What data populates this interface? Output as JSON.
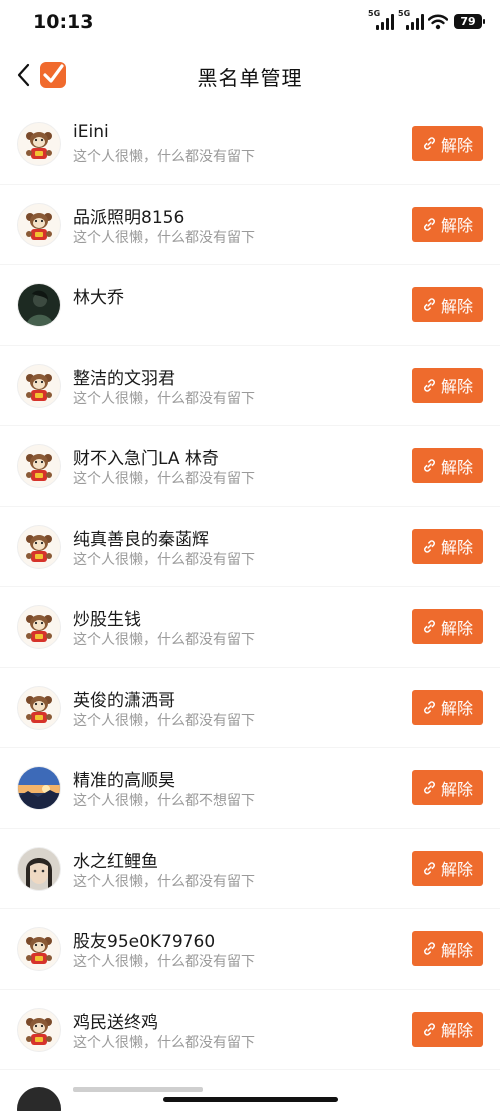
{
  "status_bar": {
    "time": "10:13",
    "signal1_label": "5G",
    "signal2_label": "5G",
    "battery": "79"
  },
  "nav": {
    "title": "黑名单管理",
    "back_icon": "chevron-left-icon",
    "logo_icon": "checkmark-logo-icon"
  },
  "list": {
    "unblock_label": "解除",
    "unblock_icon": "link-icon",
    "items": [
      {
        "name": "iEini",
        "bio": "这个人很懒，什么都没有留下",
        "avatar": "cartoon"
      },
      {
        "name": "品派照明8156",
        "bio": "这个人很懒，什么都没有留下",
        "avatar": "cartoon"
      },
      {
        "name": "林大乔",
        "bio": "",
        "avatar": "photo-dark"
      },
      {
        "name": "整洁的文羽君",
        "bio": "这个人很懒，什么都没有留下",
        "avatar": "cartoon"
      },
      {
        "name": "财不入急门LA 林奇",
        "bio": "这个人很懒，什么都没有留下",
        "avatar": "cartoon"
      },
      {
        "name": "纯真善良的秦菡辉",
        "bio": "这个人很懒，什么都没有留下",
        "avatar": "cartoon"
      },
      {
        "name": "炒股生钱",
        "bio": "这个人很懒，什么都没有留下",
        "avatar": "cartoon"
      },
      {
        "name": "英俊的潇洒哥",
        "bio": "这个人很懒，什么都没有留下",
        "avatar": "cartoon"
      },
      {
        "name": "精准的高顺昊",
        "bio": "这个人很懒，什么都不想留下",
        "avatar": "photo-sky"
      },
      {
        "name": "水之红鲤鱼",
        "bio": "这个人很懒，什么都没有留下",
        "avatar": "photo-face"
      },
      {
        "name": "股友95e0K79760",
        "bio": "这个人很懒，什么都没有留下",
        "avatar": "cartoon"
      },
      {
        "name": "鸡民送终鸡",
        "bio": "这个人很懒，什么都没有留下",
        "avatar": "cartoon"
      }
    ]
  },
  "colors": {
    "accent": "#ee6b2d",
    "bio_text": "#9a9a9a"
  }
}
